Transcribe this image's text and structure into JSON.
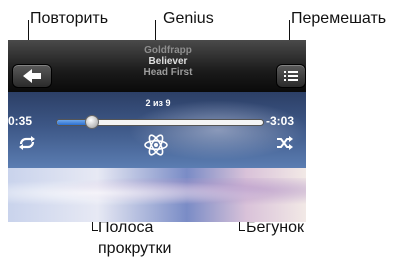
{
  "callouts": {
    "repeat": "Повторить",
    "genius": "Genius",
    "shuffle": "Перемешать",
    "scrub_bar_line1": "Полоса",
    "scrub_bar_line2": "прокрутки",
    "playhead": "Бегунок"
  },
  "now_playing": {
    "artist": "Goldfrapp",
    "song": "Believer",
    "album": "Head First",
    "track_count": "2 из 9",
    "elapsed": "0:35",
    "remaining": "-3:03",
    "progress_fraction": 0.16
  },
  "icons": {
    "back": "back-arrow-icon",
    "list": "track-list-icon",
    "repeat": "repeat-icon",
    "genius": "genius-atom-icon",
    "shuffle": "shuffle-icon"
  },
  "colors": {
    "progress_fill": "#3a7ad8",
    "controls_background": "#3d5786",
    "callout_text": "#111111"
  }
}
